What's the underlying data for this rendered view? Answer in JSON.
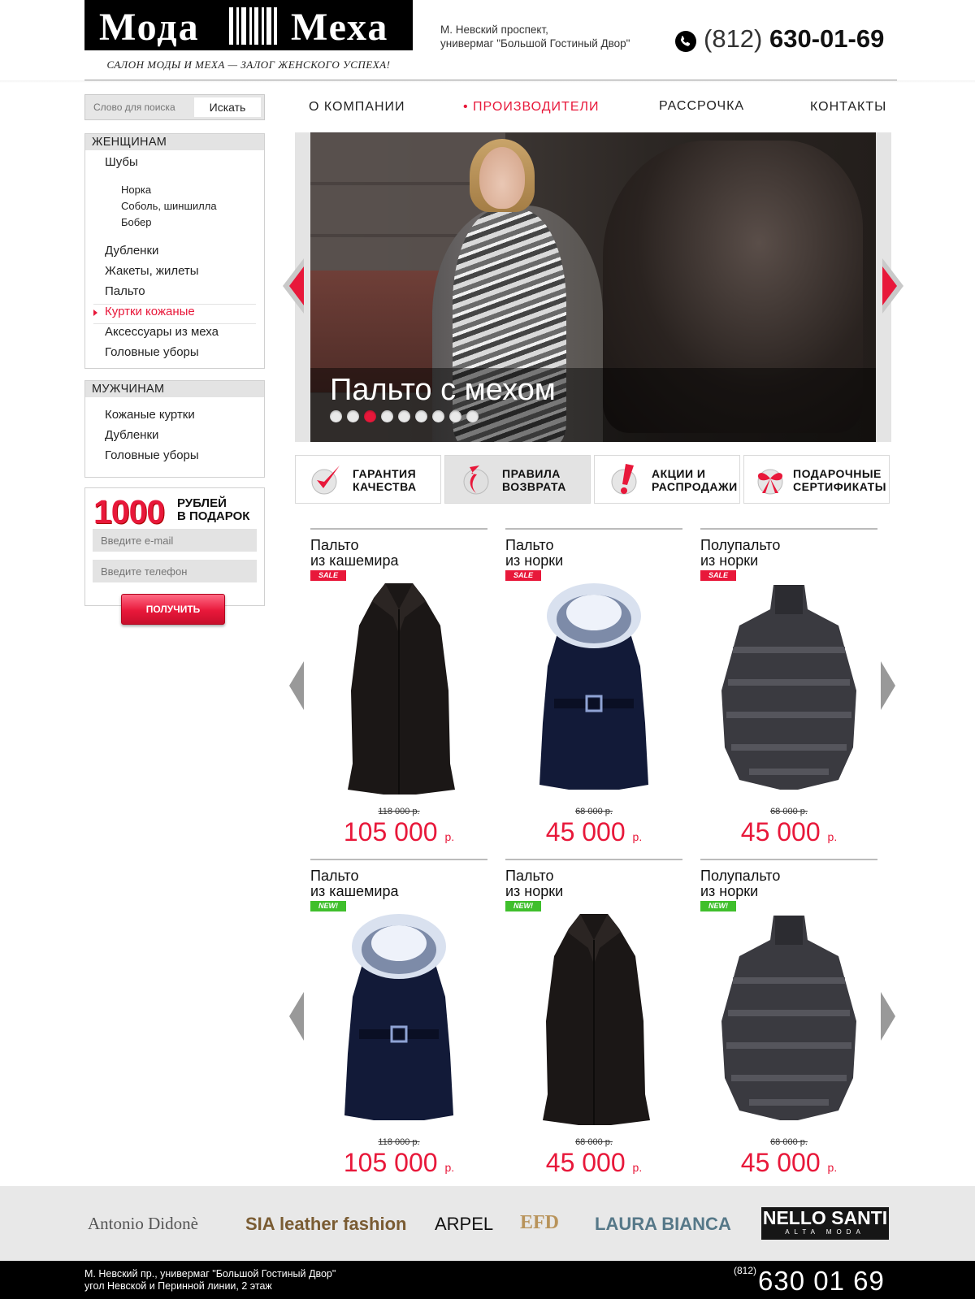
{
  "header": {
    "logo_word1": "Мода",
    "logo_word2": "Меха",
    "tagline": "САЛОН МОДЫ И МЕХА — ЗАЛОГ ЖЕНСКОГО УСПЕХА!",
    "address_line1": "М. Невский проспект,",
    "address_line2": "универмаг \"Большой Гостиный Двор\"",
    "phone_code": "(812)",
    "phone_number": "630-01-69"
  },
  "search": {
    "placeholder": "Слово для поиска",
    "button": "Искать"
  },
  "nav": [
    "О КОМПАНИИ",
    "ПРОИЗВОДИТЕЛИ",
    "РАССРОЧКА",
    "КОНТАКТЫ"
  ],
  "women": {
    "title": "ЖЕНЩИНАМ",
    "items": [
      "Шубы",
      "Норка",
      "Соболь, шиншилла",
      "Бобер",
      "Дубленки",
      "Жакеты, жилеты",
      "Пальто",
      "Куртки кожаные",
      "Аксессуары из меха",
      "Головные уборы"
    ]
  },
  "men": {
    "title": "МУЖЧИНАМ",
    "items": [
      "Кожаные куртки",
      "Дубленки",
      "Головные уборы"
    ]
  },
  "promo": {
    "amount": "1000",
    "text_line1": "РУБЛЕЙ",
    "text_line2": "В ПОДАРОК",
    "email_placeholder": "Введите e-mail",
    "phone_placeholder": "Введите телефон",
    "button": "ПОЛУЧИТЬ"
  },
  "slider": {
    "caption": "Пальто с мехом",
    "dots_total": 9,
    "active_dot": 3
  },
  "features": [
    {
      "line1": "ГАРАНТИЯ",
      "line2": "КАЧЕСТВА",
      "icon": "check-icon"
    },
    {
      "line1": "ПРАВИЛА",
      "line2": "ВОЗВРАТА",
      "icon": "return-arrow-icon"
    },
    {
      "line1": "АКЦИИ И",
      "line2": "РАСПРОДАЖИ",
      "icon": "exclamation-icon"
    },
    {
      "line1": "ПОДАРОЧНЫЕ",
      "line2": "СЕРТИФИКАТЫ",
      "icon": "gift-bow-icon"
    }
  ],
  "products": [
    {
      "title": "Пальто\nиз кашемира",
      "badge": "SALE",
      "old_price": "118 000 р.",
      "price": "105 000",
      "currency": "р."
    },
    {
      "title": "Пальто\nиз норки",
      "badge": "SALE",
      "old_price": "68 000 р.",
      "price": "45 000",
      "currency": "р."
    },
    {
      "title": "Полупальто\nиз норки",
      "badge": "SALE",
      "old_price": "68 000 р.",
      "price": "45 000",
      "currency": "р."
    },
    {
      "title": "Пальто\nиз кашемира",
      "badge": "NEW!",
      "old_price": "118 000 р.",
      "price": "105 000",
      "currency": "р."
    },
    {
      "title": "Пальто\nиз норки",
      "badge": "NEW!",
      "old_price": "68 000 р.",
      "price": "45 000",
      "currency": "р."
    },
    {
      "title": "Полупальто\nиз норки",
      "badge": "NEW!",
      "old_price": "68 000 р.",
      "price": "45 000",
      "currency": "р."
    }
  ],
  "brands": [
    "Antonio Didonè",
    "SIA leather fashion",
    "ARPEL",
    "EFD",
    "LAURA BIANCA",
    "NELLO SANTI",
    "ALTA MODA"
  ],
  "footer": {
    "address_line1": "М. Невский пр., универмаг \"Большой Гостиный Двор\"",
    "address_line2": "угол Невской и Перинной линии, 2 этаж",
    "phone_code": "(812)",
    "phone_number": "630 01 69"
  },
  "colors": {
    "accent": "#e8183a",
    "new_badge": "#3fbf2c",
    "panel_gray": "#e3e3e3"
  }
}
